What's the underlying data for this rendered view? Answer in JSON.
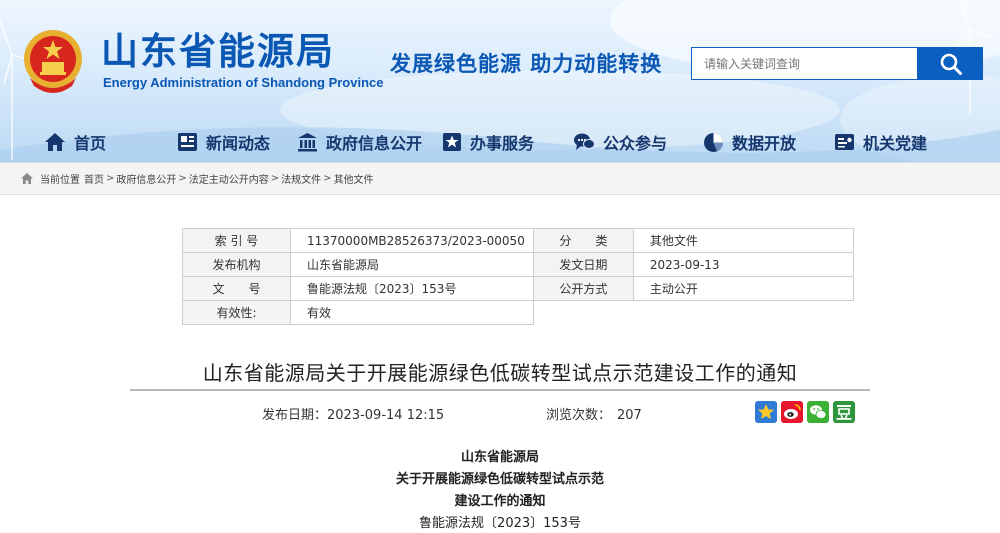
{
  "site": {
    "title_cn": "山东省能源局",
    "title_en": "Energy Administration of Shandong Province",
    "slogan": "发展绿色能源  助力动能转换"
  },
  "search": {
    "placeholder": "请输入关键词查询"
  },
  "nav": [
    {
      "label": "首页",
      "icon": "home-icon"
    },
    {
      "label": "新闻动态",
      "icon": "newspaper-icon"
    },
    {
      "label": "政府信息公开",
      "icon": "government-building-icon"
    },
    {
      "label": "办事服务",
      "icon": "star-badge-icon"
    },
    {
      "label": "公众参与",
      "icon": "chat-bubbles-icon"
    },
    {
      "label": "数据开放",
      "icon": "globe-chart-icon"
    },
    {
      "label": "机关党建",
      "icon": "party-id-icon"
    }
  ],
  "breadcrumb": {
    "prefix": "当前位置",
    "items": [
      "首页",
      "政府信息公开",
      "法定主动公开内容",
      "法规文件",
      "其他文件"
    ],
    "separator": ">"
  },
  "meta": {
    "index_label": "索 引 号",
    "index_value": "11370000MB28526373/2023-00050",
    "category_label": "分　　类",
    "category_value": "其他文件",
    "issuer_label": "发布机构",
    "issuer_value": "山东省能源局",
    "issue_date_label": "发文日期",
    "issue_date_value": "2023-09-13",
    "doc_no_label": "文　　号",
    "doc_no_value": "鲁能源法规〔2023〕153号",
    "open_mode_label": "公开方式",
    "open_mode_value": "主动公开",
    "validity_label": "有效性:",
    "validity_value": "有效"
  },
  "article": {
    "title": "山东省能源局关于开展能源绿色低碳转型试点示范建设工作的通知",
    "publish_label": "发布日期：",
    "publish_time": "2023-09-14 12:15",
    "views_label": "浏览次数：",
    "views": "207",
    "share_icons": [
      "qzone-star-icon",
      "weibo-icon",
      "wechat-icon",
      "douban-icon"
    ],
    "lines": [
      "山东省能源局",
      "关于开展能源绿色低碳转型试点示范",
      "建设工作的通知",
      "鲁能源法规〔2023〕153号"
    ]
  },
  "colors": {
    "brand_blue": "#0a57b4",
    "nav_text": "#16376e",
    "search_button": "#0b5fc1"
  }
}
